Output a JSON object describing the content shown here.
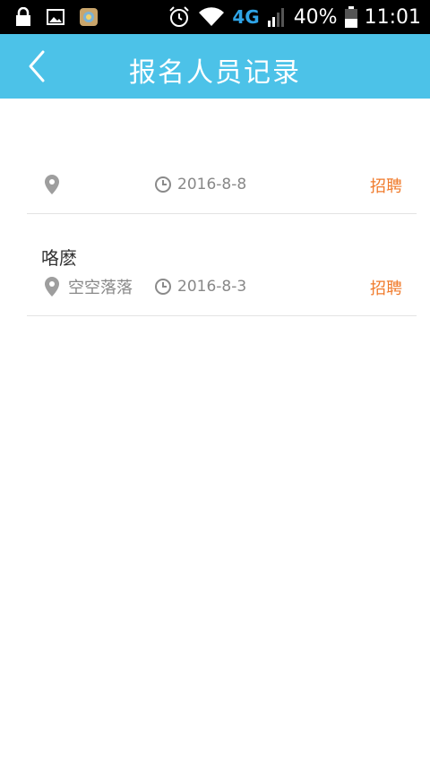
{
  "status_bar": {
    "network": "4G",
    "battery": "40%",
    "time": "11:01"
  },
  "header": {
    "title": "报名人员记录"
  },
  "records": [
    {
      "name": "",
      "location": "",
      "date": "2016-8-8",
      "tag": "招聘"
    },
    {
      "name": "咯麽",
      "location": "空空落落",
      "date": "2016-8-3",
      "tag": "招聘"
    }
  ],
  "colors": {
    "header": "#4cc2e8",
    "tag": "#f07b2c"
  }
}
